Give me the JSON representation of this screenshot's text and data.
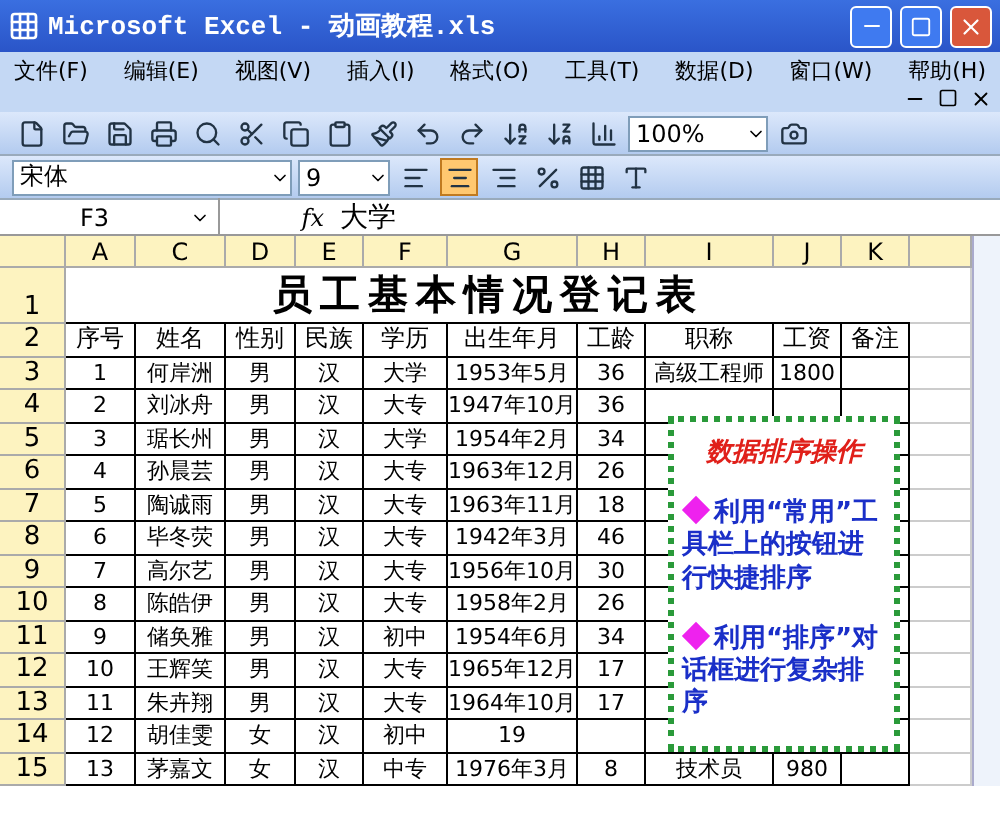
{
  "window": {
    "title": "Microsoft Excel - 动画教程.xls"
  },
  "menu": [
    {
      "label": "文件(F)"
    },
    {
      "label": "编辑(E)"
    },
    {
      "label": "视图(V)"
    },
    {
      "label": "插入(I)"
    },
    {
      "label": "格式(O)"
    },
    {
      "label": "工具(T)"
    },
    {
      "label": "数据(D)"
    },
    {
      "label": "窗口(W)"
    },
    {
      "label": "帮助(H)"
    }
  ],
  "standard_toolbar": {
    "zoom": "100%"
  },
  "format_toolbar": {
    "font": "宋体",
    "size": "9",
    "align": [
      {
        "kind": "left",
        "selected": false
      },
      {
        "kind": "center",
        "selected": true
      },
      {
        "kind": "right",
        "selected": false
      }
    ]
  },
  "formula_bar": {
    "name_box": "F3",
    "fx": "fx",
    "value": "大学"
  },
  "columns": [
    "A",
    "C",
    "D",
    "E",
    "F",
    "G",
    "H",
    "I",
    "J",
    "K"
  ],
  "sheet_title": {
    "row": "1",
    "text": "员工基本情况登记表"
  },
  "rows": [
    {
      "row": "2",
      "header": true,
      "cells": [
        "序号",
        "姓名",
        "性别",
        "民族",
        "学历",
        "出生年月",
        "工龄",
        "职称",
        "工资",
        "备注"
      ]
    },
    {
      "row": "3",
      "cells": [
        "1",
        "何岸洲",
        "男",
        "汉",
        "大学",
        "1953年5月",
        "36",
        "高级工程师",
        "1800",
        null
      ]
    },
    {
      "row": "4",
      "cells": [
        "2",
        "刘冰舟",
        "男",
        "汉",
        "大专",
        "1947年10月",
        "36",
        null,
        null,
        null
      ]
    },
    {
      "row": "5",
      "cells": [
        "3",
        "琚长州",
        "男",
        "汉",
        "大学",
        "1954年2月",
        "34",
        null,
        null,
        null
      ]
    },
    {
      "row": "6",
      "cells": [
        "4",
        "孙晨芸",
        "男",
        "汉",
        "大专",
        "1963年12月",
        "26",
        null,
        null,
        null
      ]
    },
    {
      "row": "7",
      "cells": [
        "5",
        "陶诚雨",
        "男",
        "汉",
        "大专",
        "1963年11月",
        "18",
        null,
        null,
        null
      ]
    },
    {
      "row": "8",
      "cells": [
        "6",
        "毕冬荧",
        "男",
        "汉",
        "大专",
        "1942年3月",
        "46",
        null,
        null,
        null
      ]
    },
    {
      "row": "9",
      "cells": [
        "7",
        "高尔艺",
        "男",
        "汉",
        "大专",
        "1956年10月",
        "30",
        null,
        null,
        null
      ]
    },
    {
      "row": "10",
      "cells": [
        "8",
        "陈皓伊",
        "男",
        "汉",
        "大专",
        "1958年2月",
        "26",
        null,
        null,
        null
      ]
    },
    {
      "row": "11",
      "cells": [
        "9",
        "储奂雅",
        "男",
        "汉",
        "初中",
        "1954年6月",
        "34",
        null,
        null,
        null
      ]
    },
    {
      "row": "12",
      "cells": [
        "10",
        "王辉笑",
        "男",
        "汉",
        "大专",
        "1965年12月",
        "17",
        null,
        null,
        null
      ]
    },
    {
      "row": "13",
      "cells": [
        "11",
        "朱卉翔",
        "男",
        "汉",
        "大专",
        "1964年10月",
        "17",
        null,
        null,
        null
      ]
    },
    {
      "row": "14",
      "cells": [
        "12",
        "胡佳雯",
        "女",
        "汉",
        "初中",
        "19",
        null,
        null,
        null,
        null
      ]
    },
    {
      "row": "15",
      "cells": [
        "13",
        "茅嘉文",
        "女",
        "汉",
        "中专",
        "1976年3月",
        "8",
        "技术员",
        "980",
        null
      ]
    }
  ],
  "callout": {
    "title": "数据排序操作",
    "bullets": [
      {
        "text": "利用“常用”工具栏上的按钮进行快捷排序"
      },
      {
        "text": "利用“排序”对话框进行复杂排序"
      }
    ]
  }
}
